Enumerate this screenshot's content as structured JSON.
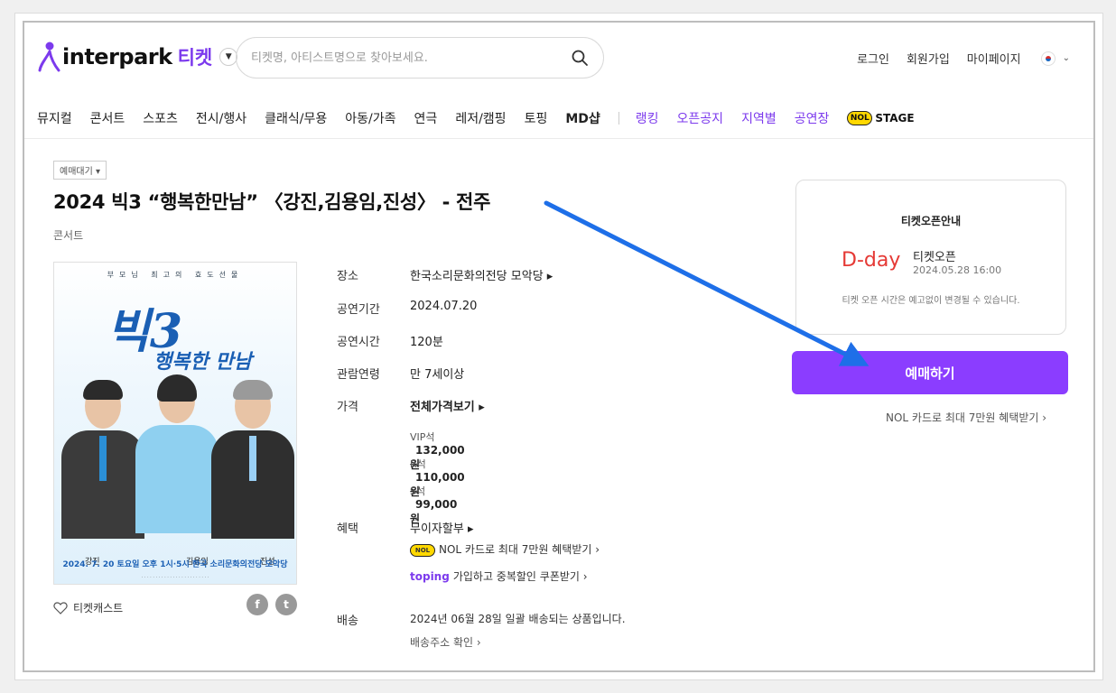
{
  "header": {
    "logo_text": "interpark",
    "logo_ticket": "티켓",
    "search_placeholder": "티켓명, 아티스트명으로 찾아보세요.",
    "links": [
      "로그인",
      "회원가입",
      "마이페이지"
    ]
  },
  "nav": {
    "items": [
      "뮤지컬",
      "콘서트",
      "스포츠",
      "전시/행사",
      "클래식/무용",
      "아동/가족",
      "연극",
      "레저/캠핑",
      "토핑",
      "MD샵"
    ],
    "highlight_items": [
      "랭킹",
      "오픈공지",
      "지역별",
      "공연장"
    ],
    "nol_badge": "NOL",
    "stage_label": "STAGE"
  },
  "product": {
    "status": "예매대기 ▾",
    "title": "2024 빅3 “행복한만남” 〈강진,김용임,진성〉 - 전주",
    "genre": "콘서트",
    "poster": {
      "top_text": "부모님 최고의 효도선물",
      "title": "빅3",
      "subtitle": "행복한 만남",
      "names": [
        "강진",
        "김용임",
        "진성"
      ],
      "date_line": "2024. 7. 20 토요일 오후 1시·5시  한국 소리문화의전당 모악당"
    },
    "cast_label": "티켓캐스트",
    "info": {
      "venue_label": "장소",
      "venue": "한국소리문화의전당 모악당",
      "period_label": "공연기간",
      "period": "2024.07.20",
      "runtime_label": "공연시간",
      "runtime": "120분",
      "age_label": "관람연령",
      "age": "만 7세이상",
      "price_label": "가격",
      "price_all": "전체가격보기",
      "prices": [
        {
          "grade": "VIP석",
          "amount": "132,000원"
        },
        {
          "grade": "R석",
          "amount": "110,000원"
        },
        {
          "grade": "S석",
          "amount": "99,000원"
        }
      ],
      "benefit_label": "혜택",
      "benefit_main": "무이자할부",
      "benefit_nol": "NOL 카드로 최대 7만원 혜택받기",
      "toping_label": "toping",
      "benefit_toping": "가입하고 중복할인 쿠폰받기",
      "delivery_label": "배송",
      "delivery_text": "2024년 06월 28일 일괄 배송되는 상품입니다.",
      "delivery_link": "배송주소 확인"
    }
  },
  "side": {
    "title": "티켓오픈안내",
    "dday": "D-day",
    "open_label": "티켓오픈",
    "open_date": "2024.05.28 16:00",
    "note": "티켓 오픈 시간은 예고없이 변경될 수 있습니다.",
    "buy_button": "예매하기",
    "card_link": "NOL 카드로 최대 7만원 혜택받기 ›"
  },
  "colors": {
    "accent": "#8b3dff",
    "brand_purple": "#7c3aed",
    "dday_red": "#e53935",
    "arrow_blue": "#1e6fe8"
  }
}
